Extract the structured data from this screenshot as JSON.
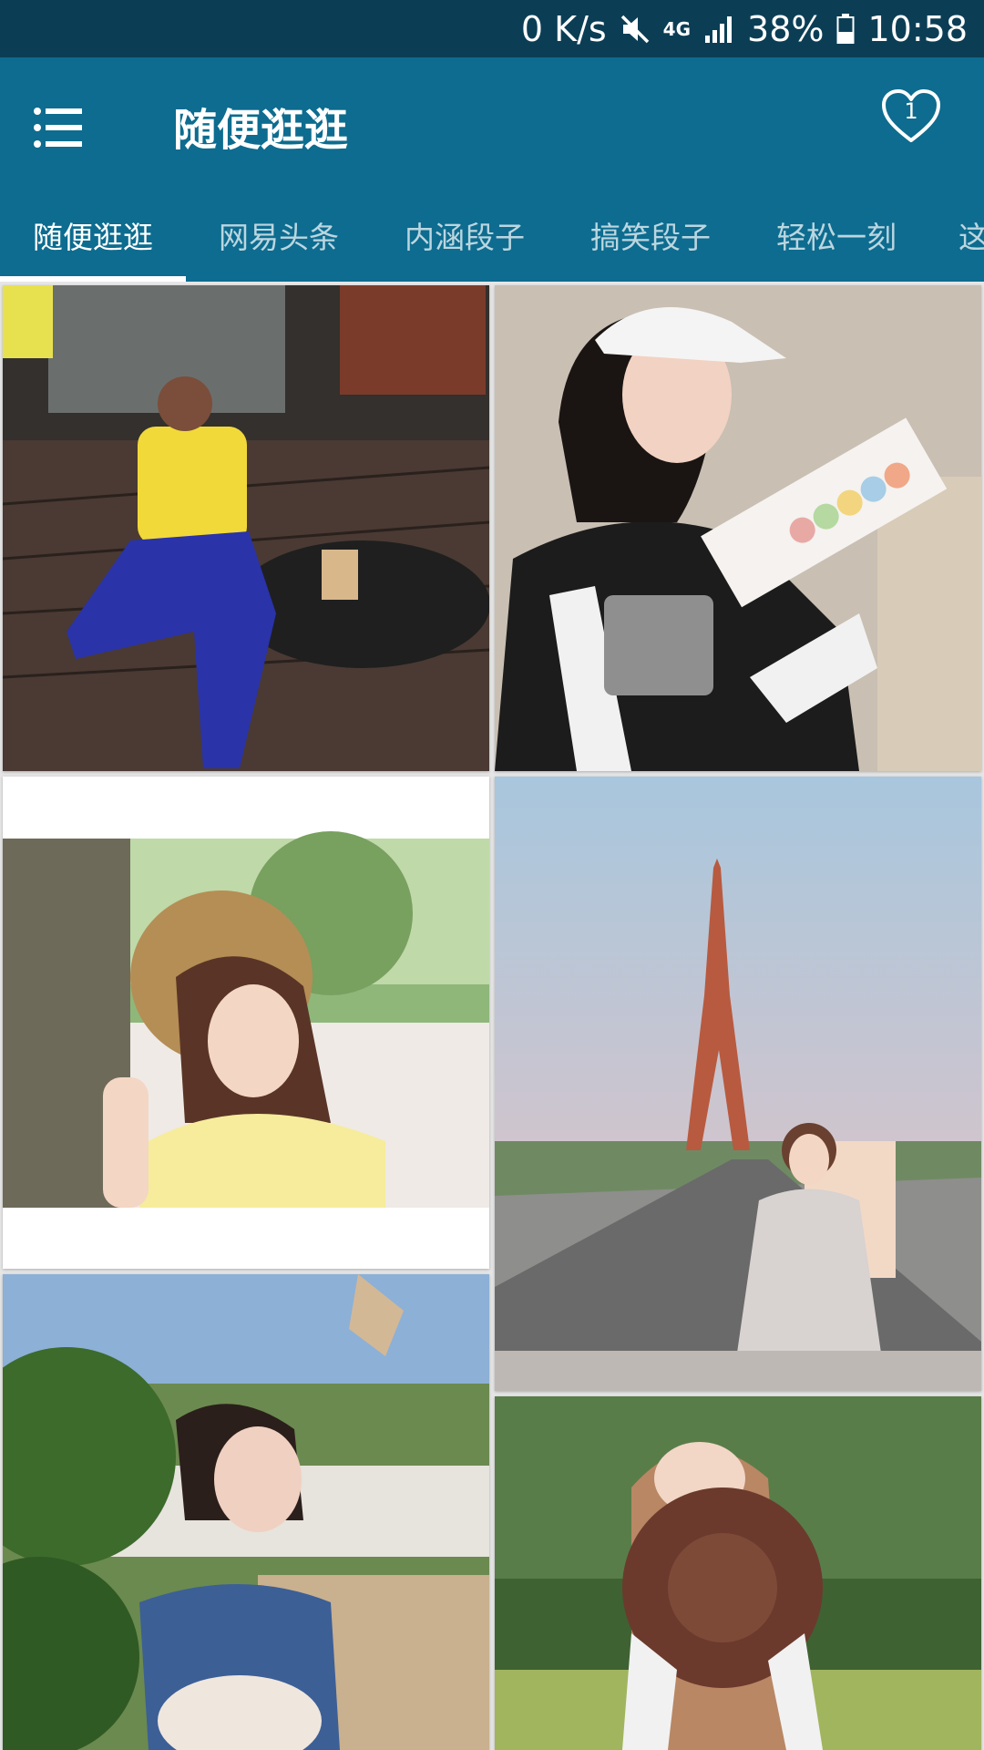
{
  "status_bar": {
    "net_speed": "0 K/s",
    "network_type": "4G",
    "battery": "38%",
    "time": "10:58",
    "icons": [
      "mute-icon",
      "signal-icon",
      "battery-icon"
    ]
  },
  "app_bar": {
    "title": "随便逛逛",
    "favorites_count": "1",
    "colors": {
      "primary": "#0d6c8f",
      "status_bar": "#0b3e55"
    }
  },
  "tabs": [
    {
      "label": "随便逛逛",
      "active": true
    },
    {
      "label": "网易头条",
      "active": false
    },
    {
      "label": "内涵段子",
      "active": false
    },
    {
      "label": "搞笑段子",
      "active": false
    },
    {
      "label": "轻松一刻",
      "active": false
    },
    {
      "label": "这",
      "active": false
    }
  ],
  "feed": {
    "items": [
      {
        "image": "woman-yellow-shirt-cafe-photo"
      },
      {
        "image": "woman-cap-macaron-box-photo"
      },
      {
        "image": "woman-straw-hat-trees-photo"
      },
      {
        "image": "woman-eiffel-tower-photo"
      },
      {
        "image": "woman-denim-dress-fan-photo"
      },
      {
        "image": "woman-brown-hat-field-photo"
      }
    ]
  }
}
